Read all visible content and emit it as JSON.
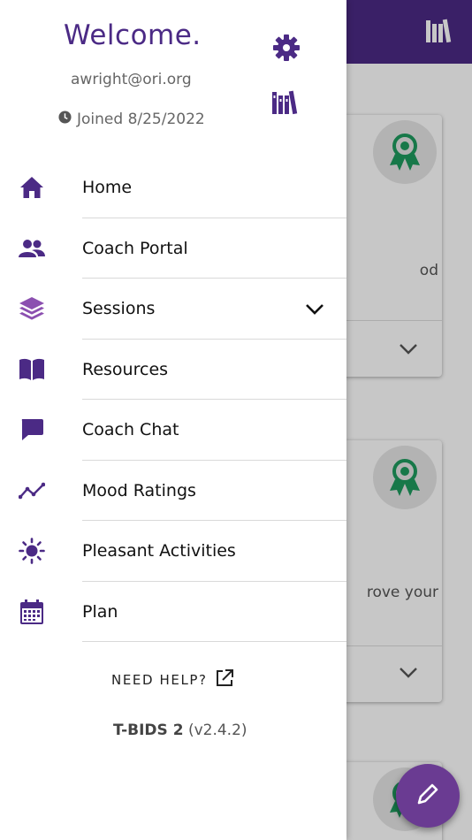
{
  "colors": {
    "brand": "#4b2a85",
    "accent": "#6a3b92",
    "sessions_icon": "#8b4fb0",
    "badge_green": "#1e9a5e"
  },
  "background": {
    "header_icon": "library-icon",
    "cards": [
      {
        "snippet": "od",
        "badge_icon": "award-icon",
        "chevron_icon": "chevron-down-icon"
      },
      {
        "snippet": "rove your",
        "badge_icon": "award-icon",
        "chevron_icon": "chevron-down-icon"
      },
      {
        "snippet": "",
        "badge_icon": "award-icon"
      }
    ],
    "fab_icon": "pencil-icon"
  },
  "drawer": {
    "welcome": "Welcome.",
    "email": "awright@ori.org",
    "joined": "Joined 8/25/2022",
    "settings_icon": "gear-icon",
    "library_icon": "library-icon",
    "nav": [
      {
        "label": "Home",
        "icon": "home-icon"
      },
      {
        "label": "Coach Portal",
        "icon": "people-icon"
      },
      {
        "label": "Sessions",
        "icon": "layers-icon",
        "expandable": true
      },
      {
        "label": "Resources",
        "icon": "book-icon"
      },
      {
        "label": "Coach Chat",
        "icon": "chat-icon"
      },
      {
        "label": "Mood Ratings",
        "icon": "trend-icon"
      },
      {
        "label": "Pleasant Activities",
        "icon": "sun-icon"
      },
      {
        "label": "Plan",
        "icon": "calendar-icon"
      }
    ],
    "help_label": "NEED HELP?",
    "app_name": "T-BIDS 2",
    "version": "(v2.4.2)"
  }
}
